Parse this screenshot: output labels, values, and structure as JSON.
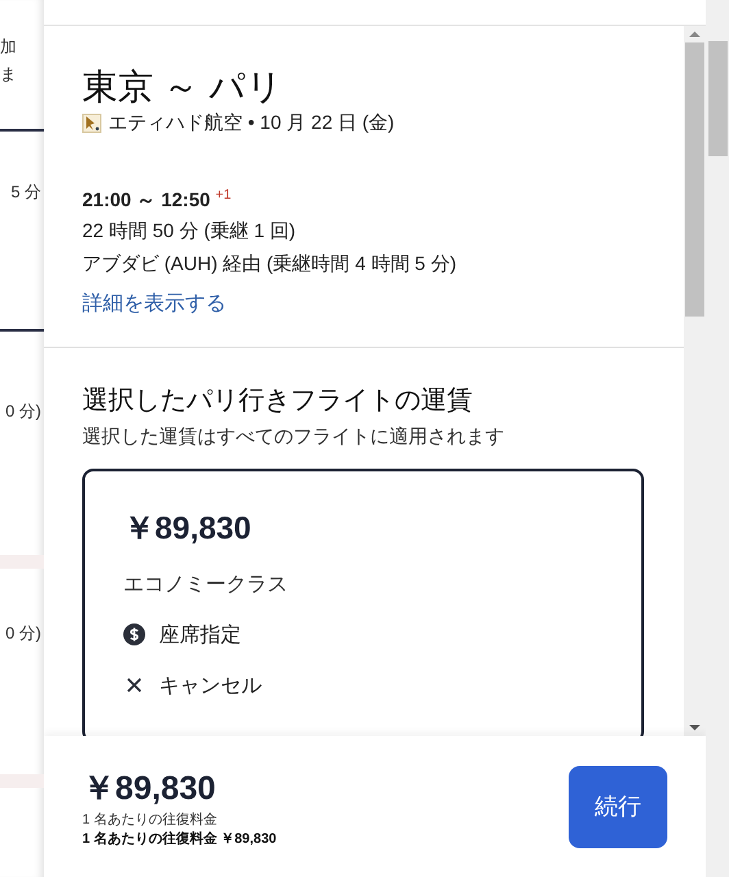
{
  "background_list": {
    "fragments": [
      {
        "text": "加"
      },
      {
        "text": "ま"
      },
      {
        "text": "5 分"
      },
      {
        "text": "0 分)"
      },
      {
        "text": "0 分)"
      }
    ]
  },
  "flight": {
    "title": "東京 ～ パリ",
    "airline": "エティハド航空 • 10 月 22 日 (金)",
    "times": "21:00 ～ 12:50",
    "day_offset": "+1",
    "duration": "22 時間 50 分 (乗継 1 回)",
    "via": "アブダビ (AUH) 経由 (乗継時間 4 時間 5 分)",
    "details_link": "詳細を表示する"
  },
  "fare": {
    "heading": "選択したパリ行きフライトの運賃",
    "subheading": "選択した運賃はすべてのフライトに適用されます",
    "card": {
      "selected": true,
      "price": "￥89,830",
      "cabin": "エコノミークラス",
      "features": [
        {
          "kind": "paid",
          "label": "座席指定"
        },
        {
          "kind": "excluded",
          "label": "キャンセル"
        }
      ]
    }
  },
  "footer": {
    "price": "￥89,830",
    "note": "1 名あたりの往復料金",
    "total": "1 名あたりの往復料金 ￥89,830",
    "continue_button": "続行"
  }
}
